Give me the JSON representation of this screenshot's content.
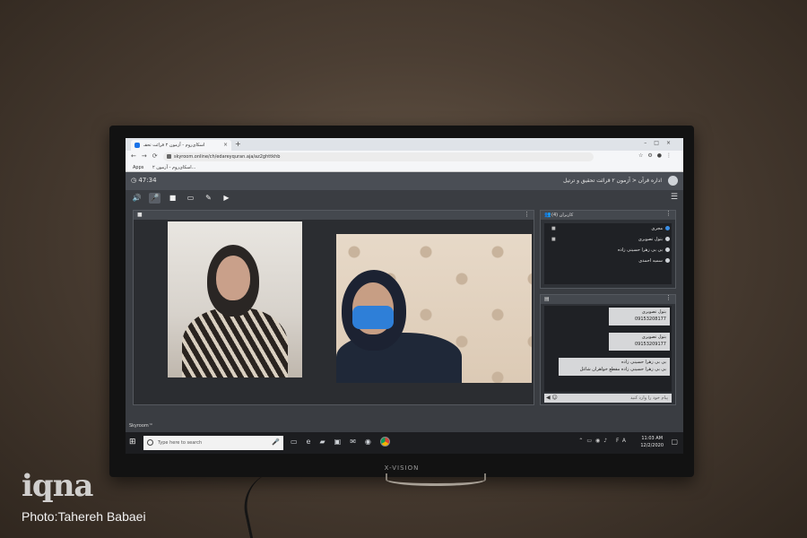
{
  "browser": {
    "tab_title": "اسکای‌روم - آزمون ۲ قرائت تحقـ",
    "url": "skyroom.online/ch/edareyquran.aja/az2ghttkhb",
    "bookmarks": [
      "Apps",
      "اسکای‌روم - آزمون ۲..."
    ]
  },
  "app": {
    "timer": "47:34",
    "room_title": "اداره قرآن < آزمون ۲ قرائت تحقیق و ترتیل",
    "users_panel_title": "کاربران (4)",
    "users": [
      {
        "name": "مجری",
        "has_video": true,
        "highlight": true
      },
      {
        "name": "بتول تصویری",
        "has_video": true,
        "highlight": false
      },
      {
        "name": "بی بی زهرا حسینی زاده",
        "has_video": false,
        "highlight": false
      },
      {
        "name": "سمیه احمدی",
        "has_video": false,
        "highlight": false
      }
    ],
    "chat_messages": [
      {
        "lines": [
          "بتول تصویری",
          "09153208177"
        ]
      },
      {
        "lines": [
          "بتول تصویری",
          "09153209177"
        ]
      },
      {
        "lines": [
          "بی بی زهرا حسینی زاده",
          "بی بی زهرا حسینی زاده   مقطع خواهران شاغل"
        ]
      }
    ],
    "chat_placeholder": "پیام خود را وارد کنید",
    "logo_text": "Skyroom™"
  },
  "taskbar": {
    "search_placeholder": "Type here to search",
    "time": "11:03 AM",
    "date": "12/2/2020",
    "lang": "FA"
  },
  "monitor_brand": "X-VISION",
  "watermark": {
    "logo": "iqna",
    "credit": "Photo:Tahereh Babaei"
  },
  "colors": {
    "wall": "#4b3e33",
    "app_dark": "#3a3d42",
    "accent_blue": "#3b8fe6"
  }
}
